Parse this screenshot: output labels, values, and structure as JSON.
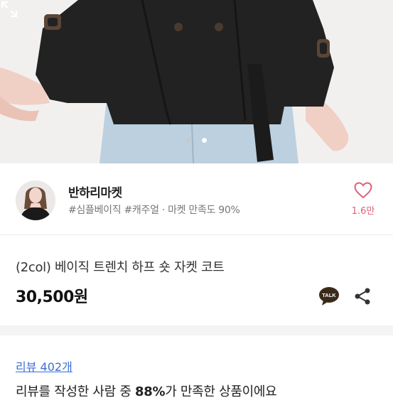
{
  "shop": {
    "name": "반하리마켓",
    "tags": "#심플베이직 #캐주얼 · 마켓 만족도 90%",
    "like_count": "1.6만"
  },
  "product": {
    "title": "(2col) 베이직 트렌치 하프 숏 자켓 코트",
    "price": "30,500원"
  },
  "image_indicator": {
    "total": 2,
    "active": 2
  },
  "talk_button_label": "TALK",
  "reviews": {
    "link_text": "리뷰 402개",
    "summary_before": "리뷰를 작성한 사람 중 ",
    "summary_highlight": "88%",
    "summary_after": "가 만족한 상품이에요"
  },
  "colors": {
    "heart": "#e0607a",
    "review_link": "#3b6fd6",
    "talk_badge": "#3a2a1a"
  }
}
